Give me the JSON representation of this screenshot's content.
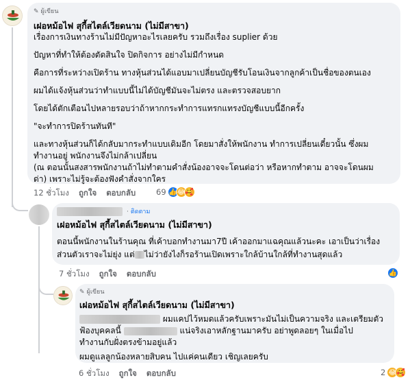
{
  "comment1": {
    "badge": "ผู้เขียน",
    "author": "เฝอหม้อไฟ สุกี้สไตล์เวียดนาม (ไม่มีสาขา)",
    "lines": [
      "เรื่องการเงินทางร้านไม่มีปัญหาอะไรเลยครับ รวมถึงเรื่อง suplier ด้วย",
      "",
      "ปัญหาที่ทำให้ต้องตัดสินใจ ปิดกิจการ อย่างไม่มีกำหนด",
      "",
      "คือการที่ระหว่างเปิดร้าน ทางหุ้นส่วนได้แอบมาเปลี่ยนบัญชีรับโอนเงินจากลูกค้าเป็นชื่อของตนเอง",
      "",
      "ผมได้แจ้งหุ้นส่วนว่าทำแบบนี้ไม่ได้บัญชีมันจะไม่ตรง และตรวจสอบยาก",
      "",
      "โดยได้ตักเตือนไปหลายรอบว่าถ้าหากกระทำการแทรกแทรงบัญชีแบบนี้อีกครั้ง",
      "",
      "\"จะทำการปิดร้านทันที\"",
      "",
      "และทางหุ้นส่วนก็ได้กลับมากระทำแบบเดิมอีก โดยมาสั่งให้พนักงาน ทำการเปลี่ยนเดี๋ยวนั้น ซึ่งผม",
      "ทำงานอยู่ พนักงานจึงไม่กล้าเปลี่ยน",
      "(ณ ตอนนั้นสงสารพนักงานถ้าไม่ทำตามคำสั่งน้องอาจจะโดนต่อว่า หรือหากทำตาม อาจจะโดนผม",
      "ด่า) เพราะไม่รู้จะต้องฟังคำสั่งจากใคร"
    ],
    "time": "12 ชั่วโมง",
    "like": "ถูกใจ",
    "reply": "ตอบกลับ",
    "reaction_count": "69"
  },
  "comment2": {
    "badge": "ติดตาม",
    "author": "เฝอหม้อไฟ สุกี้สไตล์เวียดนาม (ไม่มีสาขา)",
    "line1": "ตอนนี้พนักงานในร้านคุณ ที่เค้าบอกทำงานมา7ปี เค้าออกมาแฉคุณแล้วนะคะ เอาเป็นว่าเรื่อง",
    "line2_a": "ส่วนตัวเราจะไม่ยุ่ง แต่",
    "line2_b": "ไม่ว่ายังไงก็รอร้านเปิดเพราะใกล้บ้านใกล้ที่ทำงานสุดแล้ว",
    "time": "7 ชั่วโมง",
    "like": "ถูกใจ",
    "reply": "ตอบกลับ"
  },
  "comment3": {
    "badge": "ผู้เขียน",
    "author": "เฝอหม้อไฟ สุกี้สไตล์เวียดนาม (ไม่มีสาขา)",
    "line1": "ผมแคปไว้หมดแล้วครับเพราะมันไม่เป็นความจริง และเตรียมตัว",
    "line2_a": "ฟ้องบุคคลนี้",
    "line2_b": "แน่จริงเอาหลักฐานมาครับ อย่าพูดลอยๆ ในเมื่อไป",
    "line3": "ทำงานกับฝั่งตรงข้ามอยู่แล้ว",
    "line4": "ผมดูแลลูกน้องหลายสิบคน ไปแค่คนเดียว เชิญเลยครับ",
    "time": "6 ชั่วโมง",
    "like": "ถูกใจ",
    "reply": "ตอบกลับ",
    "reaction_count": "2"
  },
  "colors": {
    "bubble": "#f0f2f5",
    "like_blue": "#1877f2",
    "meta_gray": "#65676b",
    "thread_line": "#ced0d4"
  },
  "icons": [
    "restaurant-avatar-icon",
    "pen-badge-icon",
    "follow-icon",
    "like-reaction-icon",
    "haha-reaction-icon",
    "care-reaction-icon"
  ]
}
